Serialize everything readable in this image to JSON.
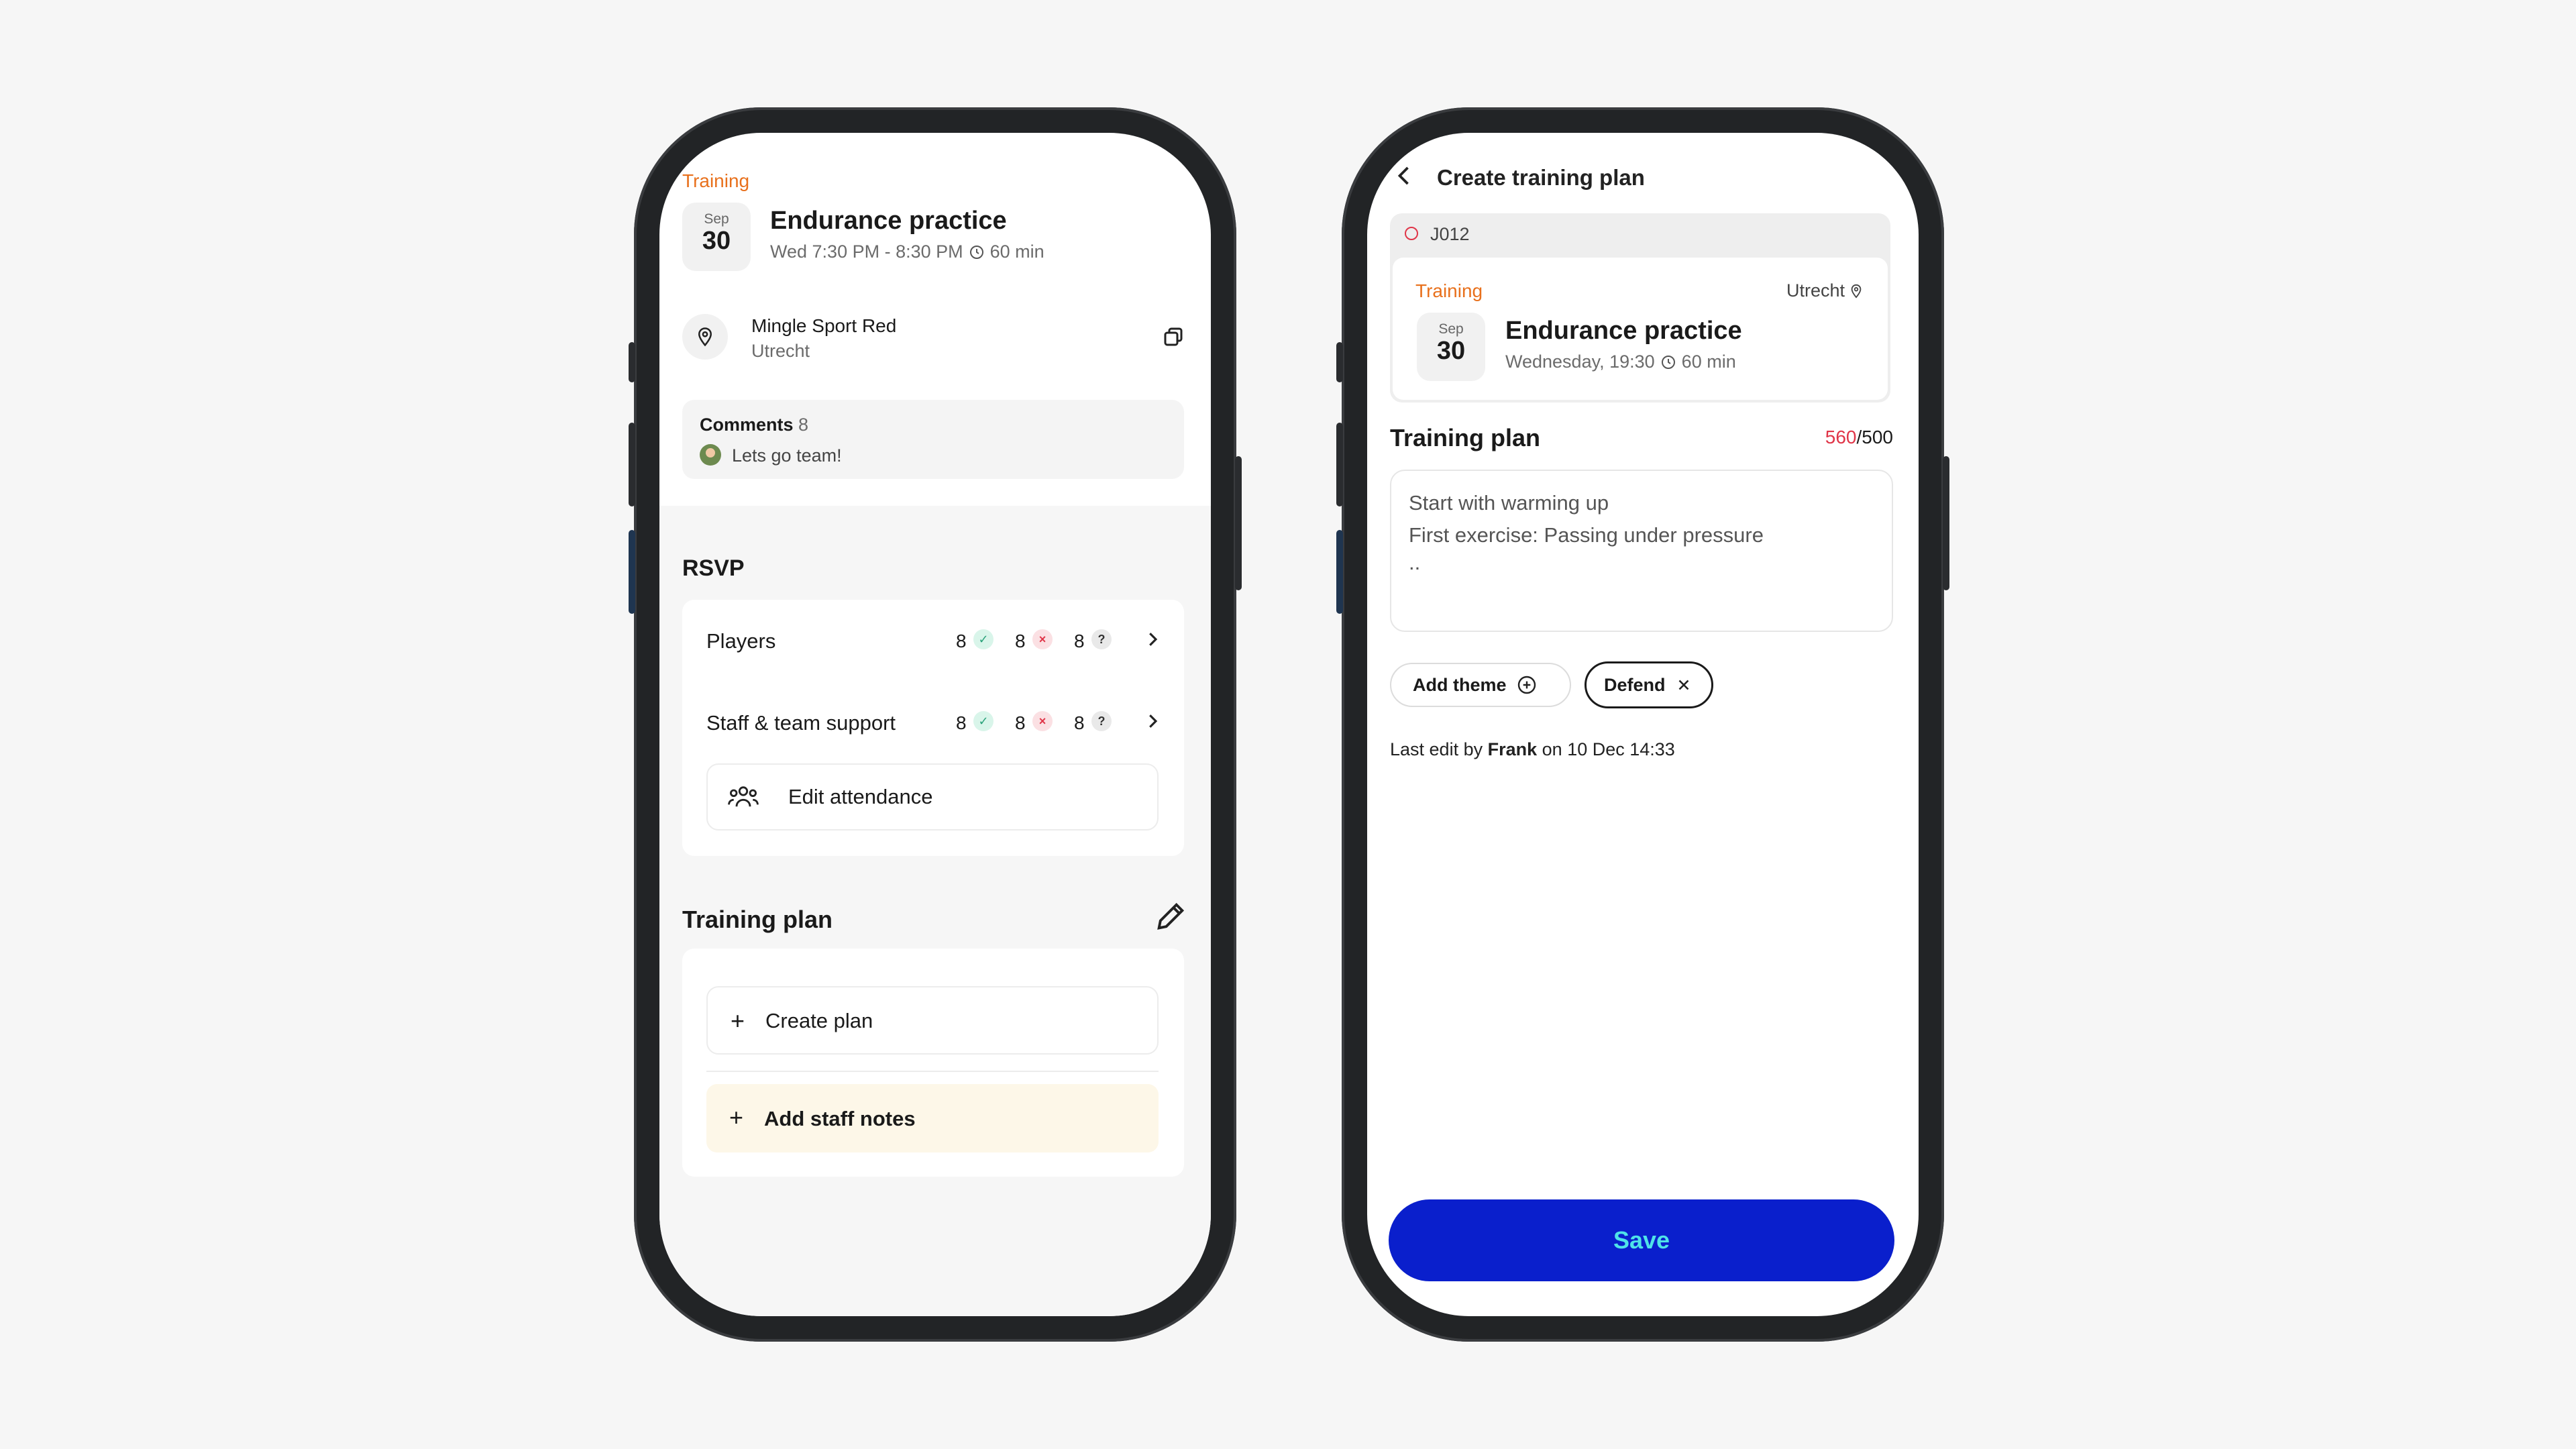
{
  "left": {
    "category": "Training",
    "date": {
      "month": "Sep",
      "day": "30"
    },
    "title": "Endurance practice",
    "time": "Wed 7:30 PM - 8:30 PM",
    "duration": "60 min",
    "location": {
      "name": "Mingle Sport Red",
      "city": "Utrecht"
    },
    "comments": {
      "label": "Comments",
      "count": "8",
      "preview": "Lets go team!"
    },
    "rsvp": {
      "heading": "RSVP",
      "rows": [
        {
          "label": "Players",
          "yes": "8",
          "no": "8",
          "maybe": "8"
        },
        {
          "label": "Staff & team support",
          "yes": "8",
          "no": "8",
          "maybe": "8"
        }
      ],
      "edit_label": "Edit attendance"
    },
    "plan": {
      "heading": "Training plan",
      "create_label": "Create plan",
      "staff_label": "Add staff notes"
    }
  },
  "right": {
    "header_title": "Create training plan",
    "team_code": "J012",
    "event": {
      "category": "Training",
      "city": "Utrecht",
      "date": {
        "month": "Sep",
        "day": "30"
      },
      "title": "Endurance practice",
      "time": "Wednesday, 19:30",
      "duration": "60 min"
    },
    "plan": {
      "heading": "Training plan",
      "count_used": "560",
      "count_max": "/500",
      "lines": [
        "Start with warming up",
        "First exercise: Passing under pressure",
        ".."
      ]
    },
    "themes": {
      "add_label": "Add theme",
      "selected": "Defend"
    },
    "last_edit": {
      "prefix": "Last edit by",
      "name": "Frank",
      "suffix": "on 10 Dec 14:33"
    },
    "save_label": "Save"
  },
  "colors": {
    "accent_orange": "#e8701c",
    "save_blue": "#0a1fcc",
    "save_text": "#4fe3e8",
    "over_limit": "#e03548",
    "staff_bg": "#fdf7e8"
  }
}
